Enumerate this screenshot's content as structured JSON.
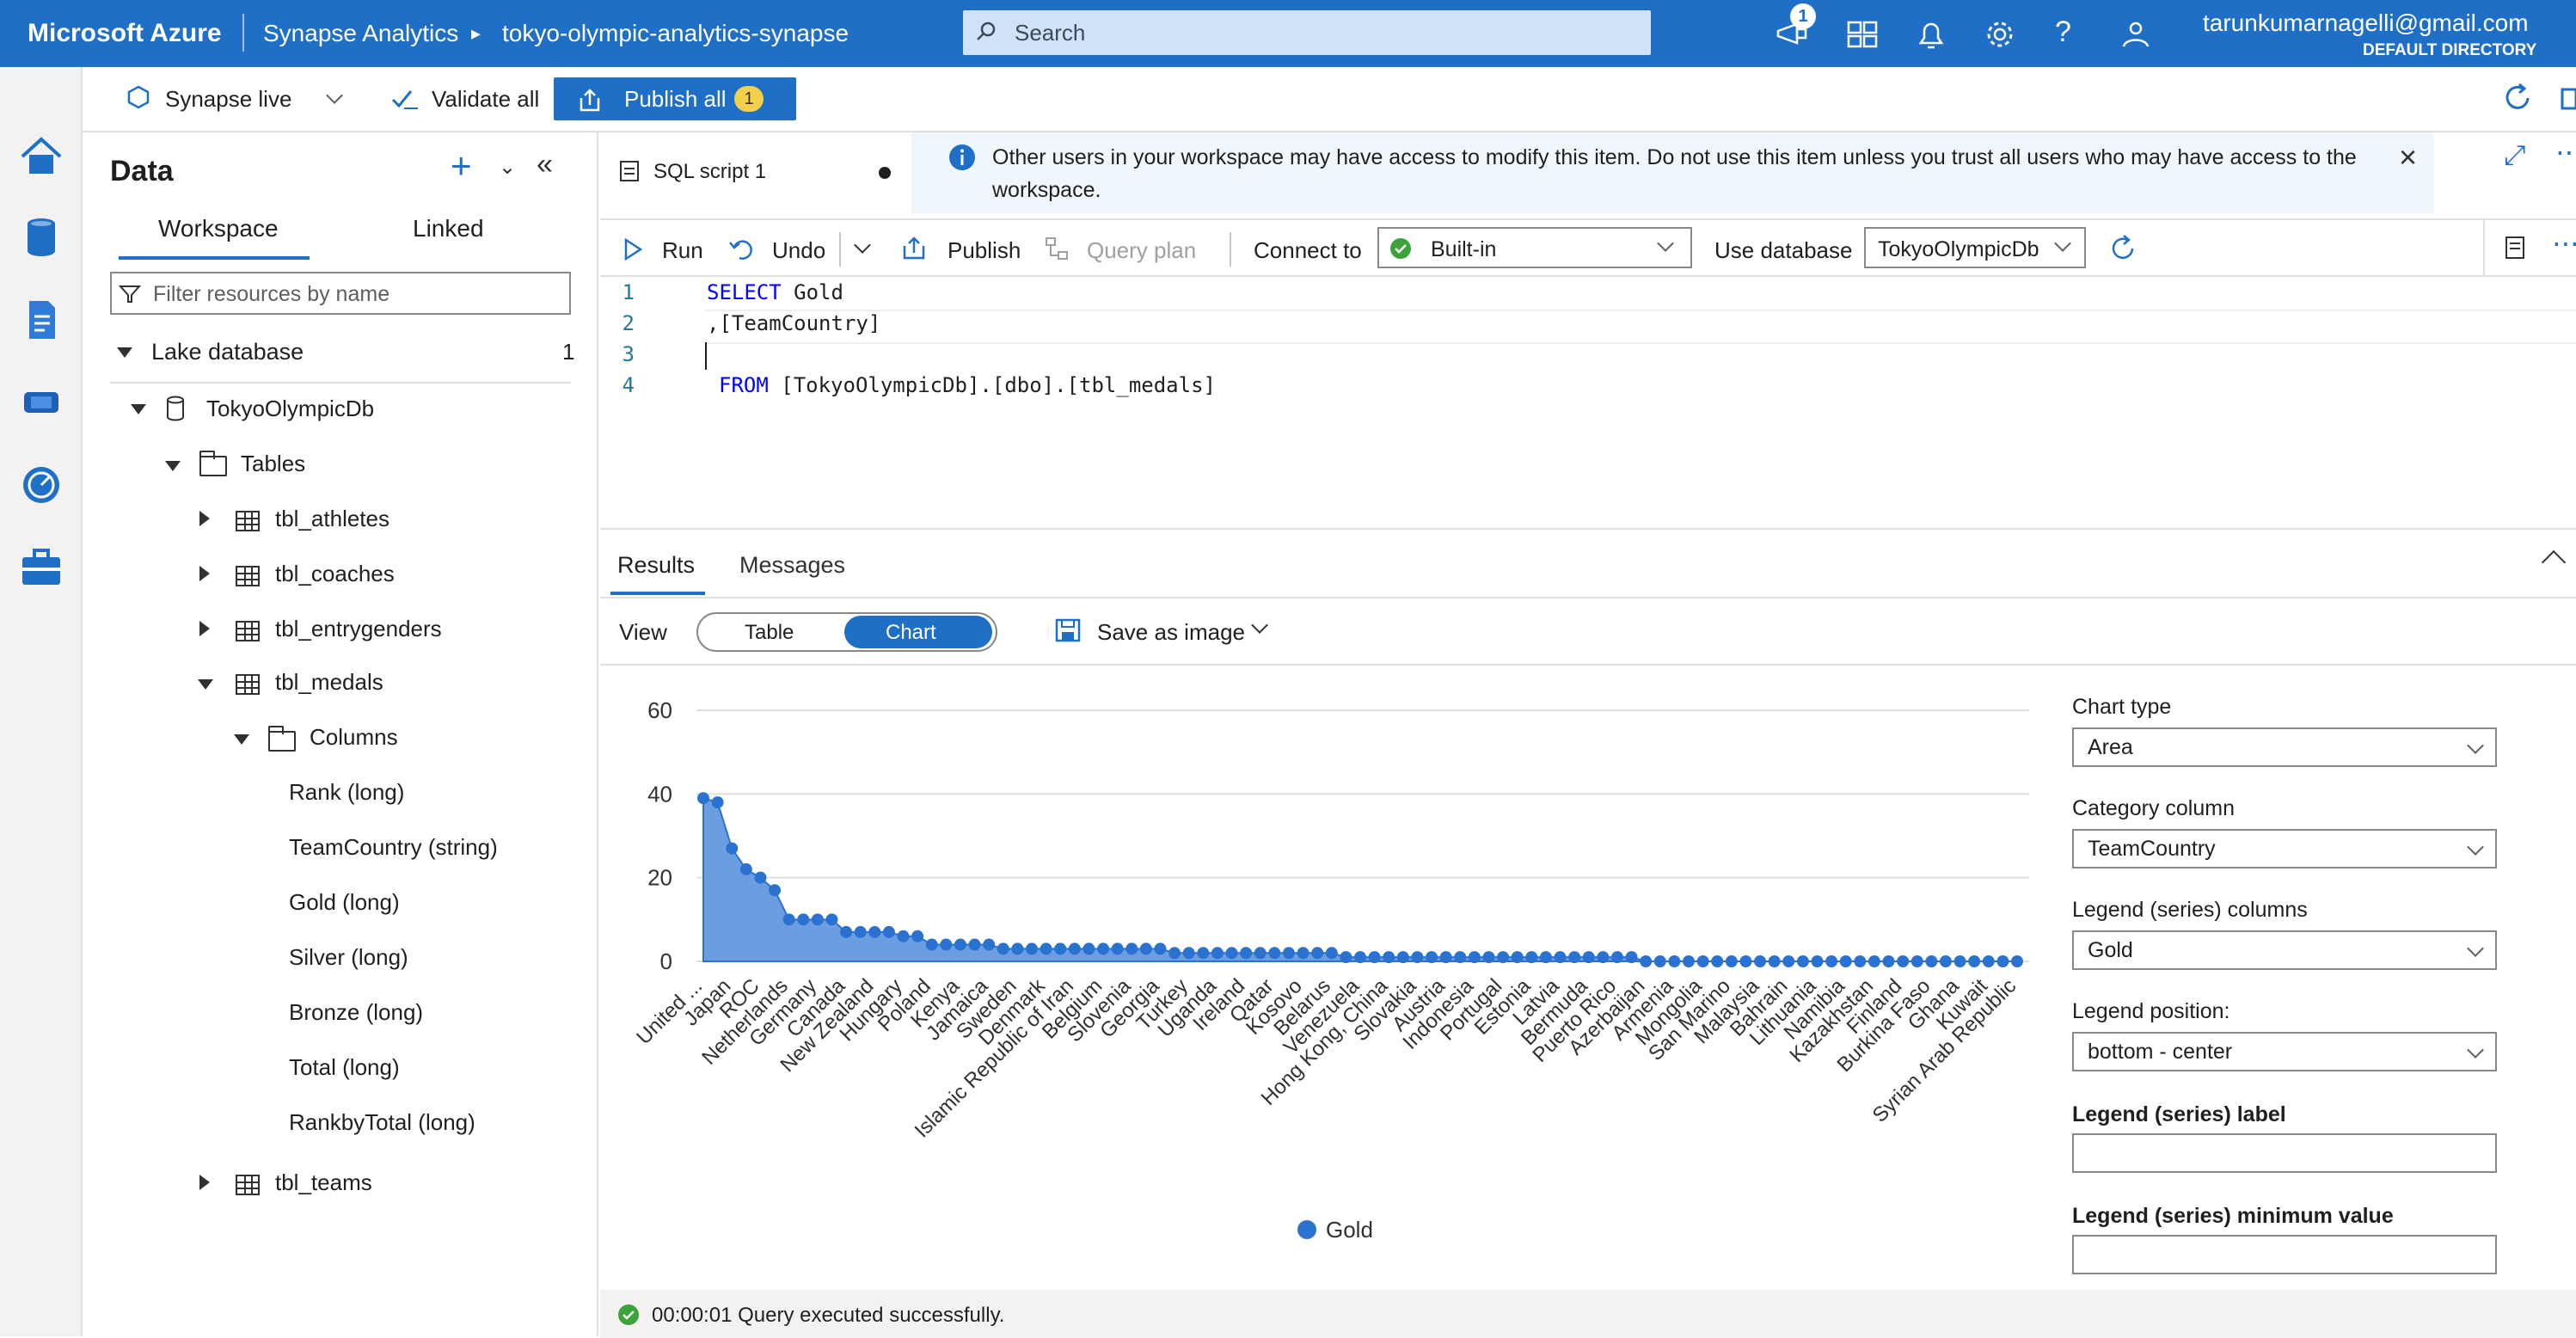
{
  "top_bar": {
    "brand": "Microsoft Azure",
    "service": "Synapse Analytics",
    "workspace": "tokyo-olympic-analytics-synapse",
    "search_placeholder": "Search",
    "notification_count": "1",
    "user_email": "tarunkumarnagelli@gmail.com",
    "directory": "DEFAULT DIRECTORY"
  },
  "toolbar": {
    "synapse_live": "Synapse live",
    "validate_all": "Validate all",
    "publish_all": "Publish all",
    "publish_count": "1"
  },
  "data_pane": {
    "title": "Data",
    "tabs": [
      "Workspace",
      "Linked"
    ],
    "filter_placeholder": "Filter resources by name",
    "lake_database": "Lake database",
    "lake_count": "1",
    "database": "TokyoOlympicDb",
    "tables_label": "Tables",
    "tables": [
      "tbl_athletes",
      "tbl_coaches",
      "tbl_entrygenders",
      "tbl_medals",
      "tbl_teams"
    ],
    "columns_label": "Columns",
    "columns": [
      "Rank (long)",
      "TeamCountry (string)",
      "Gold (long)",
      "Silver (long)",
      "Bronze (long)",
      "Total (long)",
      "RankbyTotal (long)"
    ]
  },
  "script_tab": {
    "name": "SQL script 1"
  },
  "info_bar": {
    "message": "Other users in your workspace may have access to modify this item. Do not use this item unless you trust all users who may have access to the workspace."
  },
  "script_toolbar": {
    "run": "Run",
    "undo": "Undo",
    "publish": "Publish",
    "query_plan": "Query plan",
    "connect_to": "Connect to",
    "connect_value": "Built-in",
    "use_database": "Use database",
    "database_value": "TokyoOlympicDb"
  },
  "code": {
    "line_numbers": [
      "1",
      "2",
      "3",
      "4"
    ],
    "l1_kw": "SELECT",
    "l1_rest": " Gold",
    "l2": ",[TeamCountry]",
    "l4_kw": "FROM",
    "l4_rest": " [TokyoOlympicDb].[dbo].[tbl_medals]"
  },
  "results": {
    "tabs": [
      "Results",
      "Messages"
    ],
    "view_label": "View",
    "view_table": "Table",
    "view_chart": "Chart",
    "save_as_image": "Save as image",
    "status": "00:00:01 Query executed successfully."
  },
  "chart_settings": {
    "chart_type_label": "Chart type",
    "chart_type": "Area",
    "category_label": "Category column",
    "category": "TeamCountry",
    "legend_cols_label": "Legend (series) columns",
    "legend_cols": "Gold",
    "legend_pos_label": "Legend position:",
    "legend_pos": "bottom - center",
    "legend_label_label": "Legend (series) label",
    "legend_min_label": "Legend (series) minimum value"
  },
  "colors": {
    "accent": "#1f6fc7",
    "series": "#2b72d0",
    "area": "#6a9ee0"
  },
  "chart_data": {
    "type": "area",
    "ylim": [
      0,
      60
    ],
    "yticks": [
      0,
      20,
      40,
      60
    ],
    "legend": "bottom-center",
    "categories_shown": [
      "United ...",
      "Japan",
      "ROC",
      "Netherlands",
      "Germany",
      "Canada",
      "New Zealand",
      "Hungary",
      "Poland",
      "Kenya",
      "Jamaica",
      "Sweden",
      "Denmark",
      "Islamic Republic of Iran",
      "Belgium",
      "Slovenia",
      "Georgia",
      "Turkey",
      "Uganda",
      "Ireland",
      "Qatar",
      "Kosovo",
      "Belarus",
      "Venezuela",
      "Hong Kong, China",
      "Slovakia",
      "Austria",
      "Indonesia",
      "Portugal",
      "Estonia",
      "Latvia",
      "Bermuda",
      "Puerto Rico",
      "Azerbaijan",
      "Armenia",
      "Mongolia",
      "San Marino",
      "Malaysia",
      "Bahrain",
      "Lithuania",
      "Namibia",
      "Kazakhstan",
      "Finland",
      "Burkina Faso",
      "Ghana",
      "Kuwait",
      "Syrian Arab Republic"
    ],
    "series": [
      {
        "name": "Gold",
        "values": [
          39,
          38,
          27,
          22,
          20,
          17,
          10,
          10,
          10,
          10,
          7,
          7,
          7,
          7,
          6,
          6,
          4,
          4,
          4,
          4,
          4,
          3,
          3,
          3,
          3,
          3,
          3,
          3,
          3,
          3,
          3,
          3,
          3,
          2,
          2,
          2,
          2,
          2,
          2,
          2,
          2,
          2,
          2,
          2,
          2,
          1,
          1,
          1,
          1,
          1,
          1,
          1,
          1,
          1,
          1,
          1,
          1,
          1,
          1,
          1,
          1,
          1,
          1,
          1,
          1,
          1,
          0,
          0,
          0,
          0,
          0,
          0,
          0,
          0,
          0,
          0,
          0,
          0,
          0,
          0,
          0,
          0,
          0,
          0,
          0,
          0,
          0,
          0,
          0,
          0,
          0,
          0,
          0
        ]
      }
    ]
  }
}
